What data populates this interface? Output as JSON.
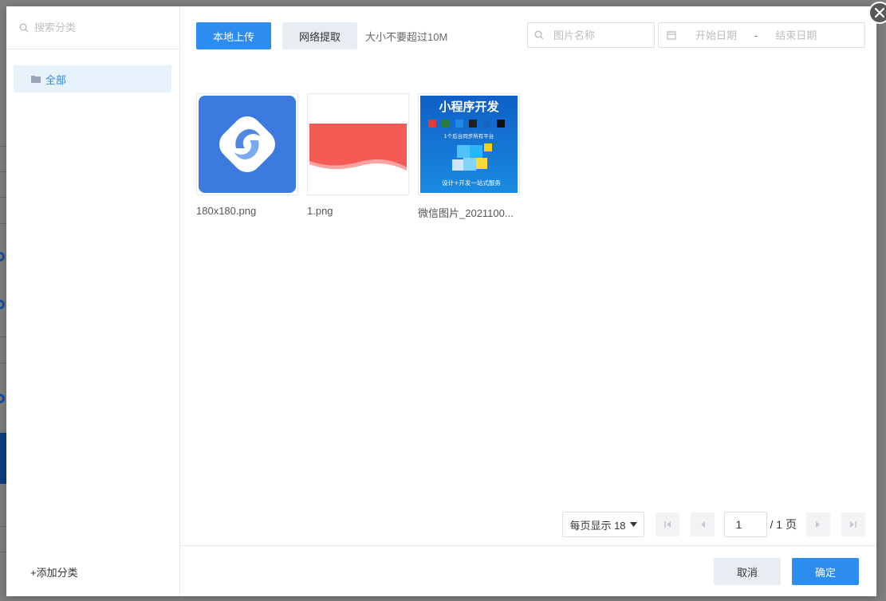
{
  "sidebar": {
    "search_placeholder": "搜索分类",
    "categories": [
      {
        "label": "全部"
      }
    ],
    "add_category_label": "+添加分类"
  },
  "toolbar": {
    "upload_local_label": "本地上传",
    "network_fetch_label": "网络提取",
    "size_hint": "大小不要超过10M"
  },
  "filters": {
    "name_placeholder": "图片名称",
    "start_date_placeholder": "开始日期",
    "date_separator": "-",
    "end_date_placeholder": "结束日期"
  },
  "images": [
    {
      "name": "180x180.png",
      "kind": "app-logo",
      "colors": {
        "bg": "#3c7ae0"
      }
    },
    {
      "name": "1.png",
      "kind": "red-banner",
      "colors": {
        "fill": "#f45b55"
      }
    },
    {
      "name": "微信图片_2021100...",
      "kind": "promo",
      "title": "小程序开发",
      "subtitle": "1个后台同步所有平台",
      "footer": "设计+开发一站式服务",
      "colors": {
        "bg": "#1565c0"
      }
    }
  ],
  "pager": {
    "page_size_label": "每页显示 18",
    "current_page": "1",
    "total_label": "/ 1 页"
  },
  "footer": {
    "cancel_label": "取消",
    "confirm_label": "确定"
  },
  "colors": {
    "primary": "#2d8cf0",
    "light_button": "#e8edf3",
    "selected_bg": "#e8f2fd"
  }
}
